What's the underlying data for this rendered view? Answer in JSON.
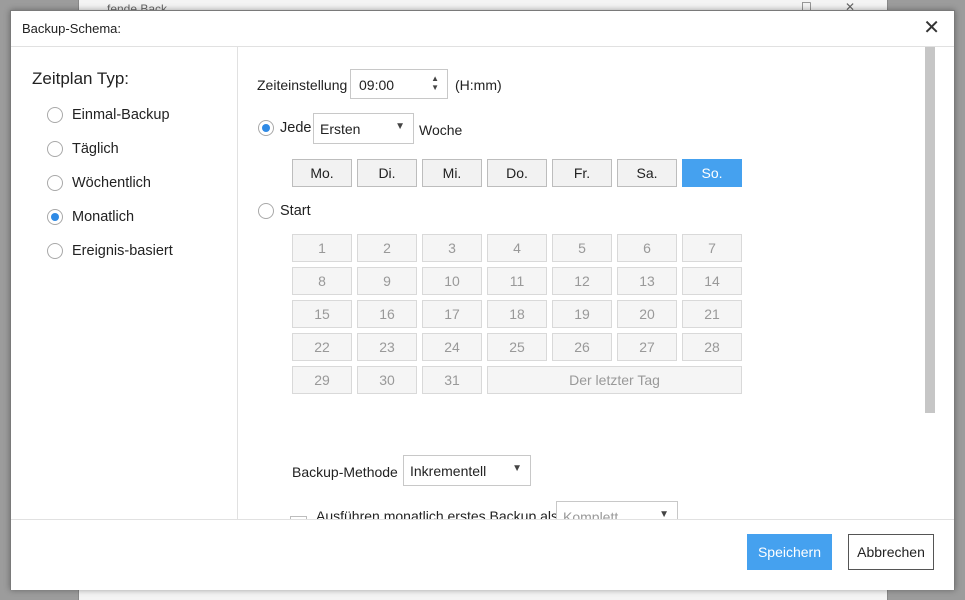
{
  "background_window": {
    "title": "...fende Back..."
  },
  "dialog": {
    "title": "Backup-Schema:",
    "close_glyph": "✕"
  },
  "schedule_type": {
    "heading": "Zeitplan Typ:",
    "options": [
      {
        "label": "Einmal-Backup",
        "checked": false
      },
      {
        "label": "Täglich",
        "checked": false
      },
      {
        "label": "Wöchentlich",
        "checked": false
      },
      {
        "label": "Monatlich",
        "checked": true
      },
      {
        "label": "Ereignis-basiert",
        "checked": false
      }
    ]
  },
  "time": {
    "label": "Zeiteinstellung",
    "value": "09:00",
    "format": "(H:mm)"
  },
  "every": {
    "label": "Jede",
    "selected": true,
    "dropdown_value": "Ersten",
    "suffix": "Woche"
  },
  "weekdays": [
    {
      "label": "Mo.",
      "active": false
    },
    {
      "label": "Di.",
      "active": false
    },
    {
      "label": "Mi.",
      "active": false
    },
    {
      "label": "Do.",
      "active": false
    },
    {
      "label": "Fr.",
      "active": false
    },
    {
      "label": "Sa.",
      "active": false
    },
    {
      "label": "So.",
      "active": true
    }
  ],
  "start": {
    "label": "Start",
    "selected": false,
    "days": [
      "1",
      "2",
      "3",
      "4",
      "5",
      "6",
      "7",
      "8",
      "9",
      "10",
      "11",
      "12",
      "13",
      "14",
      "15",
      "16",
      "17",
      "18",
      "19",
      "20",
      "21",
      "22",
      "23",
      "24",
      "25",
      "26",
      "27",
      "28",
      "29",
      "30",
      "31"
    ],
    "last_day_label": "Der letzter Tag"
  },
  "backup_method": {
    "label": "Backup-Methode",
    "value": "Inkrementell"
  },
  "monthly_first": {
    "label": "Ausführen monatlich erstes Backup als",
    "value": "Komplett",
    "checked": false
  },
  "footer": {
    "save_label": "Speichern",
    "cancel_label": "Abbrechen"
  },
  "colors": {
    "accent": "#45a1ef",
    "radio_dot": "#2f8ae5"
  }
}
